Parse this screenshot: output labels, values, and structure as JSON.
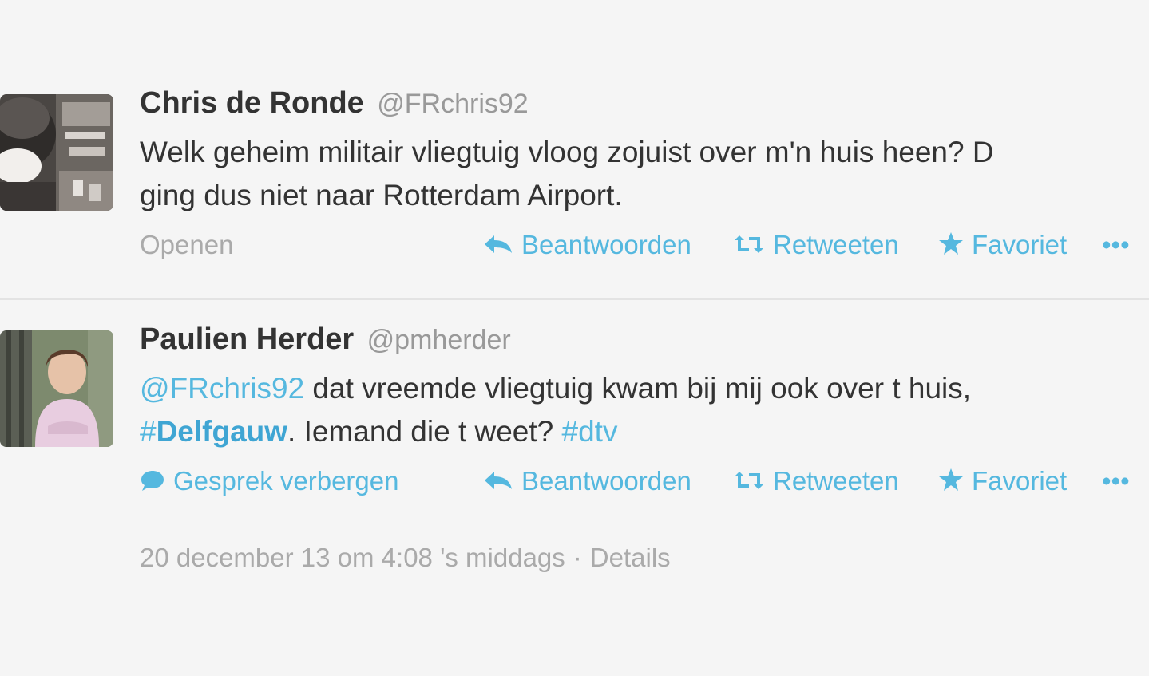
{
  "tweets": [
    {
      "fullname": "Chris de Ronde",
      "username": "@FRchris92",
      "text_line1": "Welk geheim militair vliegtuig vloog zojuist over m'n huis heen? D",
      "text_line2": "ging dus niet naar Rotterdam Airport.",
      "left_action": "Openen",
      "actions": {
        "reply": "Beantwoorden",
        "retweet": "Retweeten",
        "favorite": "Favoriet",
        "more": "•••"
      }
    },
    {
      "fullname": "Paulien Herder",
      "username": "@pmherder",
      "mention": "@FRchris92",
      "text_line1_rest": " dat vreemde vliegtuig kwam bij mij ook over t huis,",
      "hashtag1_hash": "#",
      "hashtag1_word": "Delfgauw",
      "text_line2_mid": ".  Iemand die t weet? ",
      "hashtag2": "#dtv",
      "left_action": "Gesprek verbergen",
      "actions": {
        "reply": "Beantwoorden",
        "retweet": "Retweeten",
        "favorite": "Favoriet",
        "more": "•••"
      }
    }
  ],
  "timestamp": {
    "text": "20 december 13 om 4:08 's middags",
    "separator": "·",
    "details": "Details"
  },
  "icons": {
    "reply": "reply-arrow-icon",
    "retweet": "retweet-icon",
    "favorite": "star-icon",
    "more": "more-dots-icon",
    "conversation": "speech-bubble-icon"
  },
  "colors": {
    "link": "#55b8df",
    "text": "#333333",
    "muted": "#999999",
    "background": "#f5f5f5"
  }
}
